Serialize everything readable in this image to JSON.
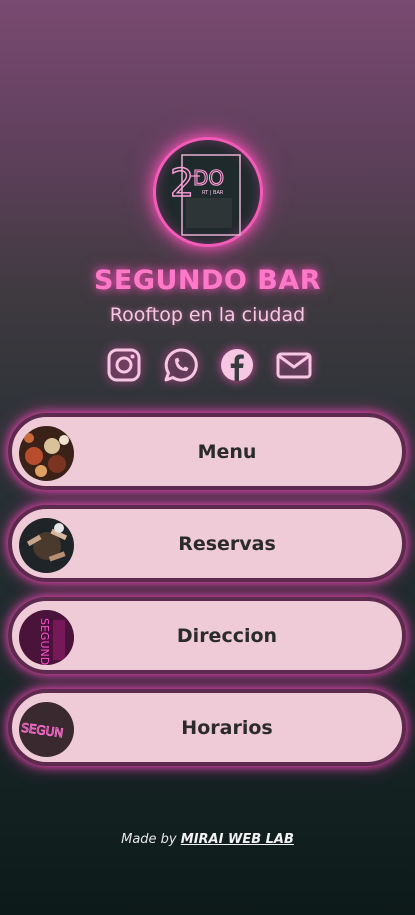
{
  "brand": {
    "title": "SEGUNDO BAR",
    "subtitle": "Rooftop en la ciudad",
    "logo_text_main": "2",
    "logo_text_do": "DO",
    "logo_text_small": "RT | BAR"
  },
  "socials": [
    {
      "name": "instagram-icon"
    },
    {
      "name": "whatsapp-icon"
    },
    {
      "name": "facebook-icon"
    },
    {
      "name": "mail-icon"
    }
  ],
  "buttons": [
    {
      "label": "Menu"
    },
    {
      "label": "Reservas"
    },
    {
      "label": "Direccion"
    },
    {
      "label": "Horarios"
    }
  ],
  "footer": {
    "prefix": "Made by",
    "link": "MIRAI WEB LAB"
  },
  "colors": {
    "neon_pink": "#ff4fb8",
    "button_bg": "#efcbd7",
    "title": "#ff79c9"
  }
}
